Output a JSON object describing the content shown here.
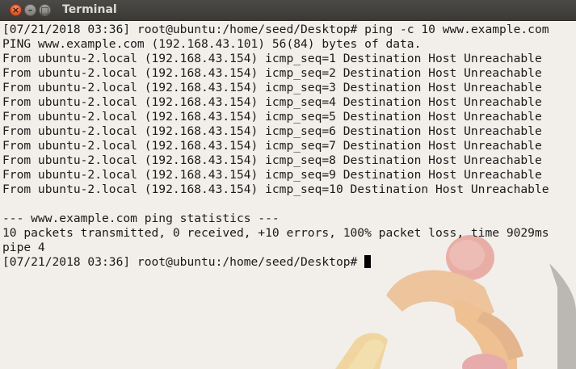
{
  "window": {
    "title": "Terminal",
    "buttons": {
      "close": "×",
      "minimize": "–",
      "maximize": "□"
    }
  },
  "terminal": {
    "lines": [
      "[07/21/2018 03:36] root@ubuntu:/home/seed/Desktop# ping -c 10 www.example.com",
      "PING www.example.com (192.168.43.101) 56(84) bytes of data.",
      "From ubuntu-2.local (192.168.43.154) icmp_seq=1 Destination Host Unreachable",
      "From ubuntu-2.local (192.168.43.154) icmp_seq=2 Destination Host Unreachable",
      "From ubuntu-2.local (192.168.43.154) icmp_seq=3 Destination Host Unreachable",
      "From ubuntu-2.local (192.168.43.154) icmp_seq=4 Destination Host Unreachable",
      "From ubuntu-2.local (192.168.43.154) icmp_seq=5 Destination Host Unreachable",
      "From ubuntu-2.local (192.168.43.154) icmp_seq=6 Destination Host Unreachable",
      "From ubuntu-2.local (192.168.43.154) icmp_seq=7 Destination Host Unreachable",
      "From ubuntu-2.local (192.168.43.154) icmp_seq=8 Destination Host Unreachable",
      "From ubuntu-2.local (192.168.43.154) icmp_seq=9 Destination Host Unreachable",
      "From ubuntu-2.local (192.168.43.154) icmp_seq=10 Destination Host Unreachable",
      "",
      "--- www.example.com ping statistics ---",
      "10 packets transmitted, 0 received, +10 errors, 100% packet loss, time 9029ms",
      "pipe 4"
    ],
    "prompt": "[07/21/2018 03:36] root@ubuntu:/home/seed/Desktop# "
  },
  "colors": {
    "titlebar": "#3c3b37",
    "close_button": "#e35a2a",
    "terminal_background": "#f2efeb",
    "text": "#1a1a1a"
  }
}
